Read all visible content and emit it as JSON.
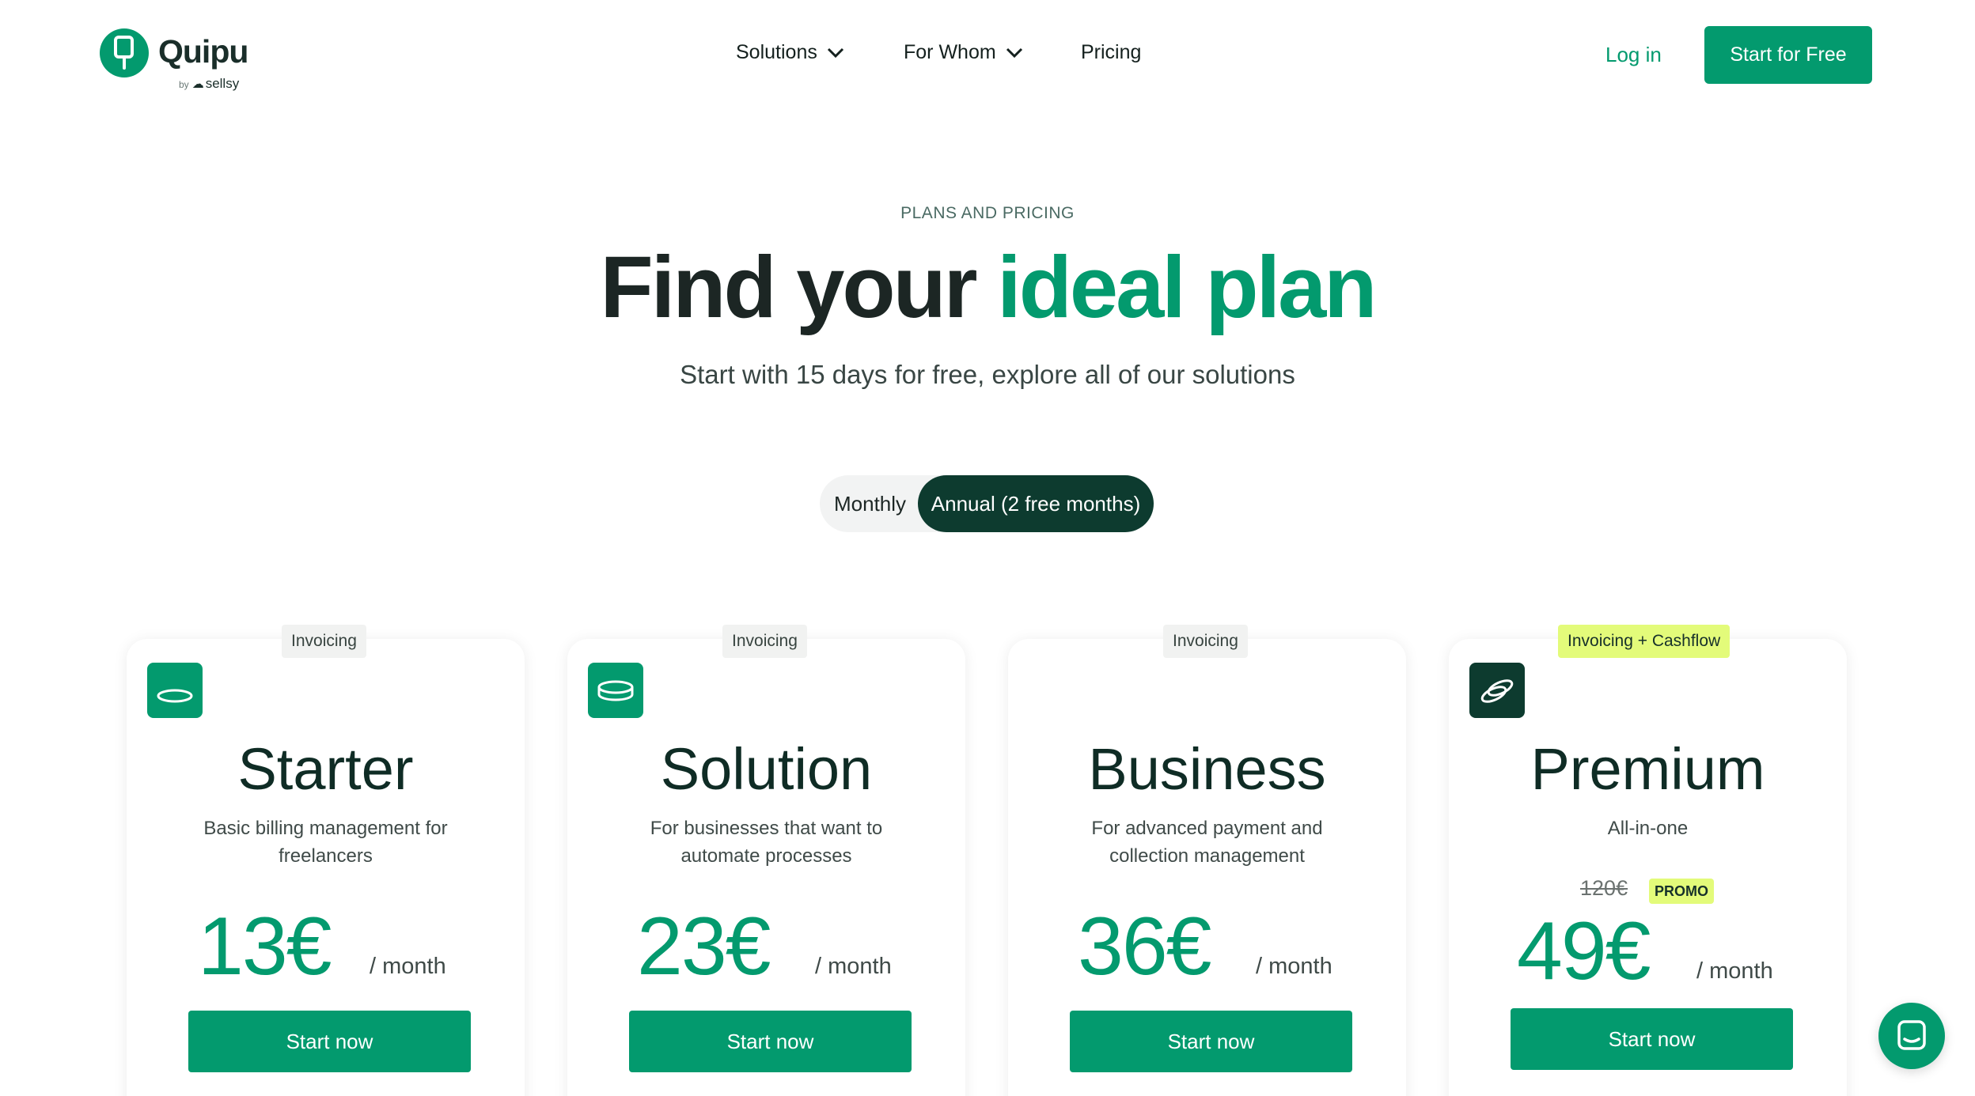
{
  "brand": {
    "name": "Quipu",
    "byline_prefix": "by",
    "byline_company": "sellsy",
    "accent_color": "#039a6e",
    "dark_color": "#0d3b2f",
    "promo_color": "#e3fb7a"
  },
  "nav": {
    "solutions": "Solutions",
    "for_whom": "For Whom",
    "pricing": "Pricing"
  },
  "header": {
    "login": "Log in",
    "cta": "Start for Free"
  },
  "hero": {
    "eyebrow": "PLANS AND PRICING",
    "title_start": "Find your",
    "title_accent": "ideal plan",
    "subtitle": "Start with 15 days for free, explore all of our solutions"
  },
  "billing_toggle": {
    "monthly": "Monthly",
    "annual": "Annual (2 free months)",
    "selected": "annual"
  },
  "plans": [
    {
      "tag": "Invoicing",
      "icon": "single-coin-icon",
      "name": "Starter",
      "description": "Basic billing management for freelancers",
      "price": "13€",
      "period": "/ month",
      "cta": "Start now"
    },
    {
      "tag": "Invoicing",
      "icon": "coin-stack-icon",
      "name": "Solution",
      "description": "For businesses that want to automate processes",
      "price": "23€",
      "period": "/ month",
      "cta": "Start now"
    },
    {
      "tag": "Invoicing",
      "icon": "",
      "name": "Business",
      "description": "For advanced payment and collection management",
      "price": "36€",
      "period": "/ month",
      "cta": "Start now"
    },
    {
      "tag": "Invoicing + Cashflow",
      "icon": "coins-icon",
      "name": "Premium",
      "description": "All-in-one",
      "old_price": "120€",
      "promo": "PROMO",
      "price": "49€",
      "period": "/ month",
      "cta": "Start now"
    }
  ],
  "chat": {
    "icon": "chat-icon"
  }
}
